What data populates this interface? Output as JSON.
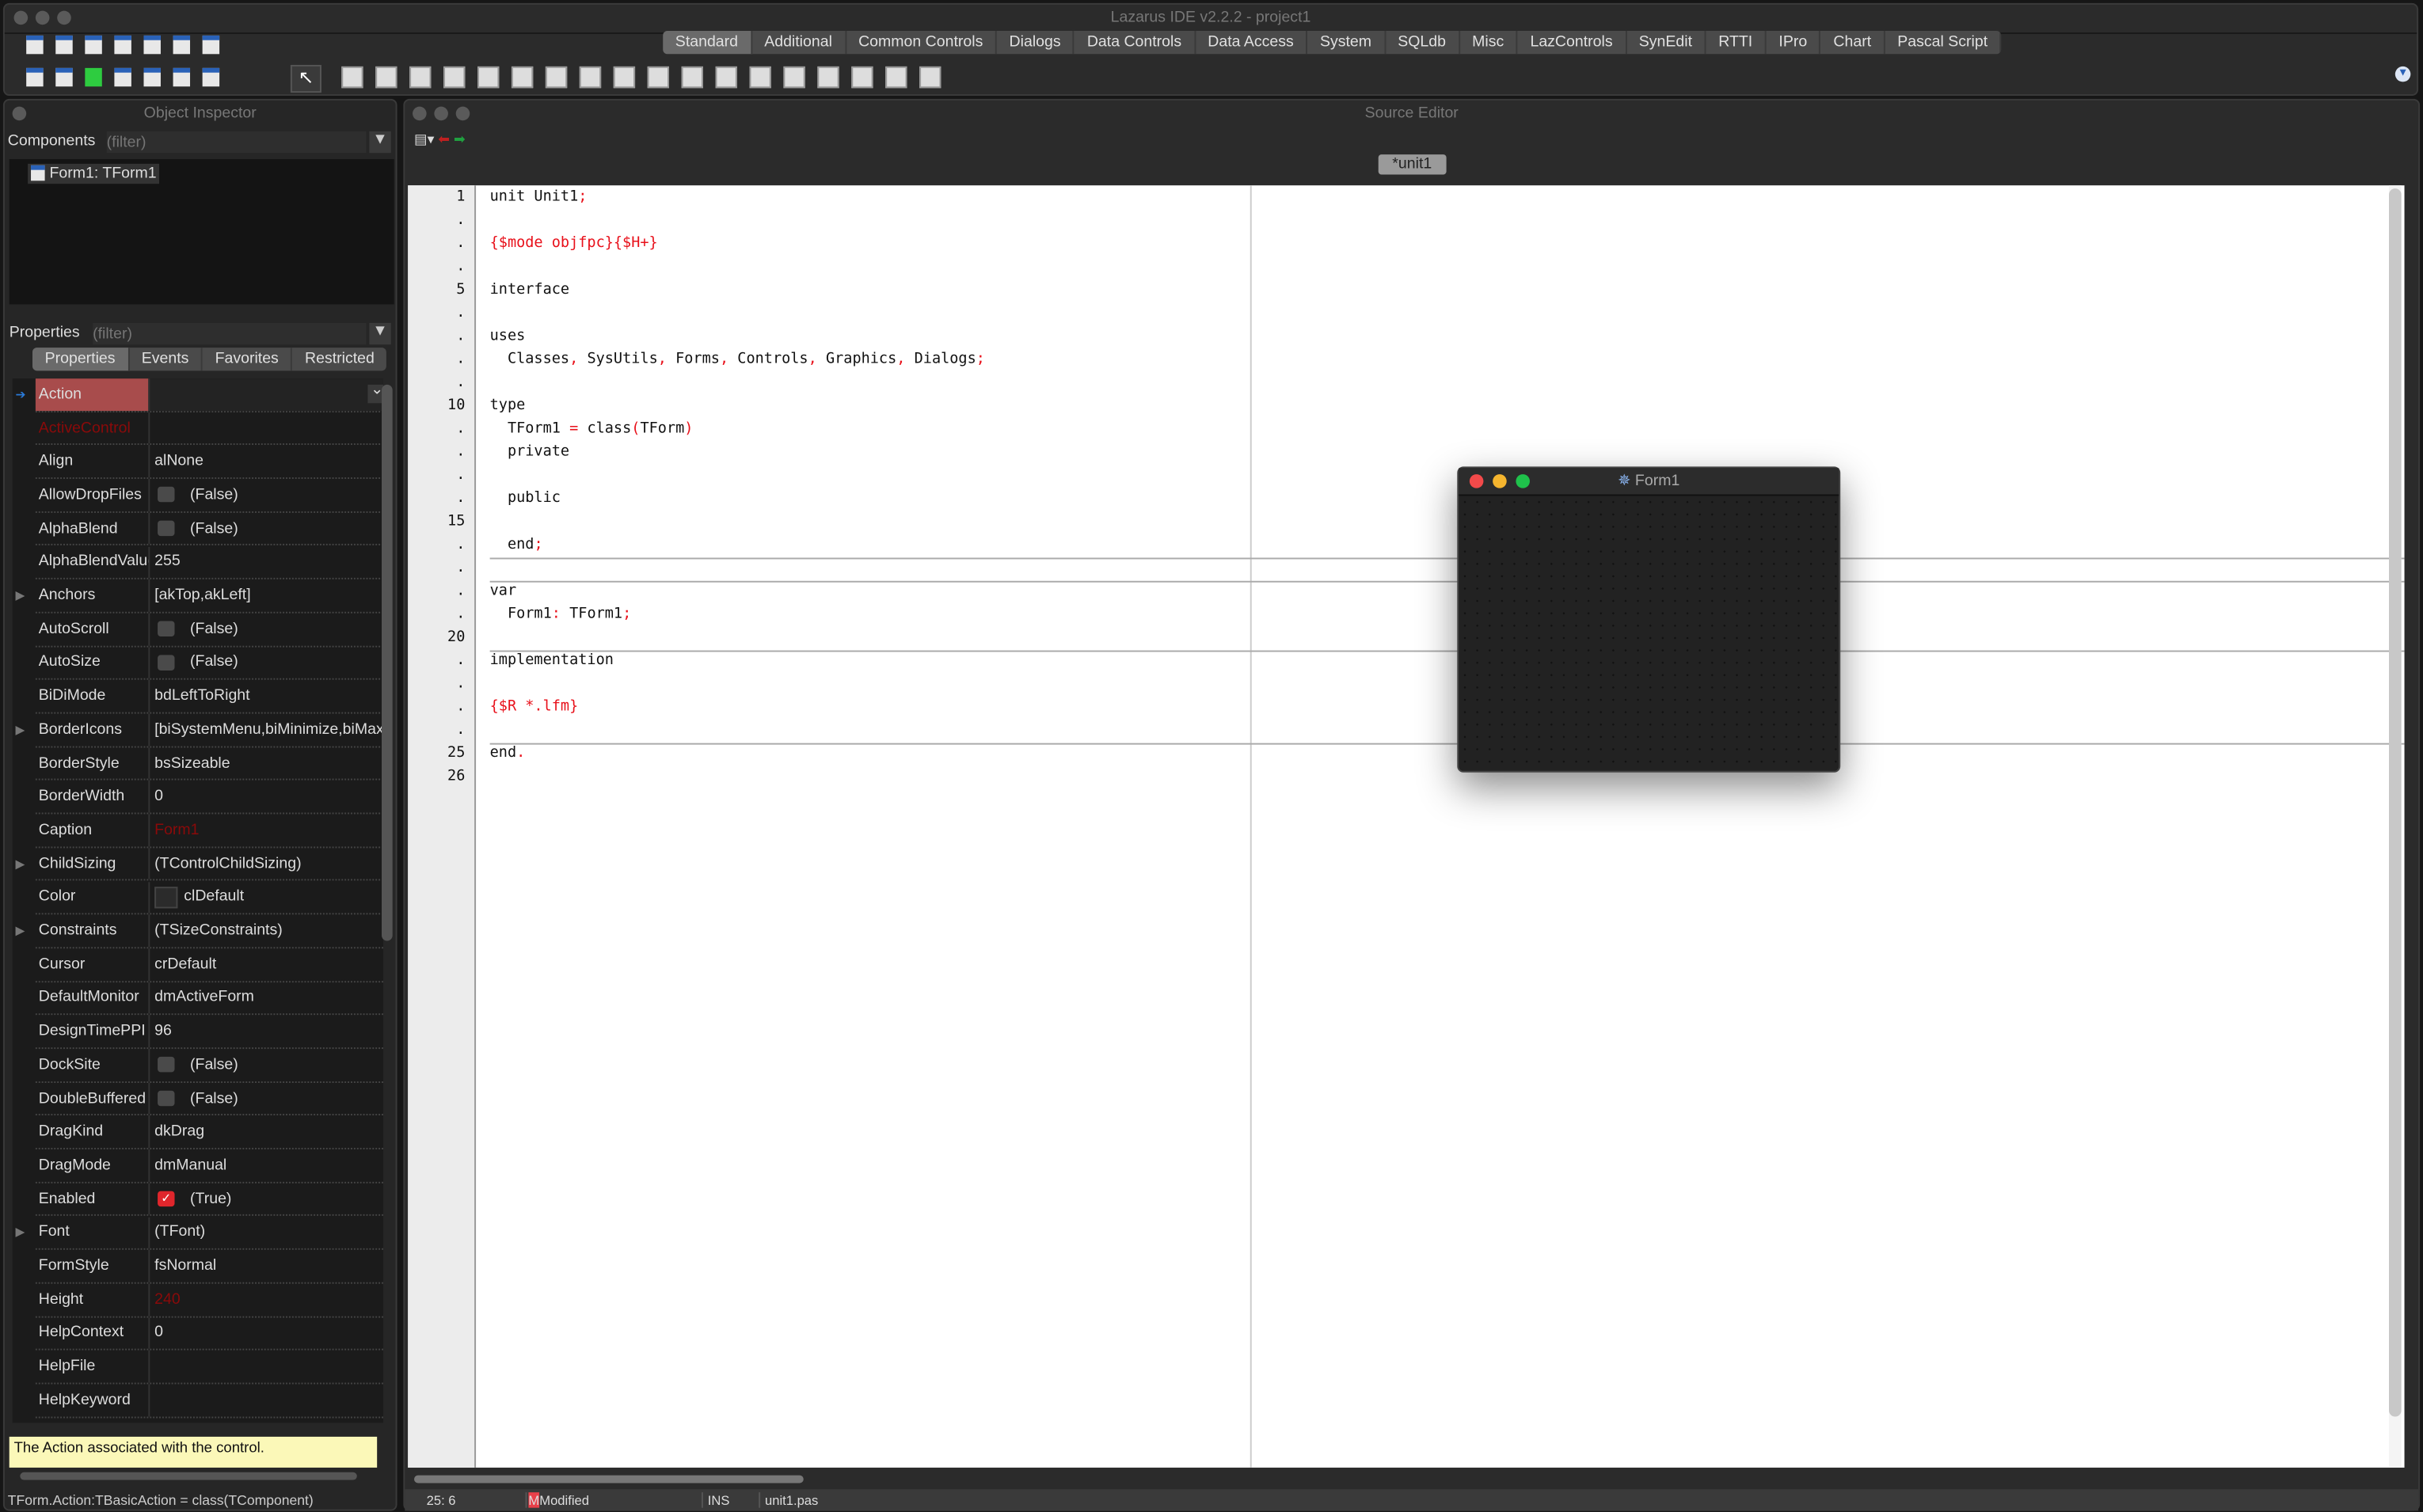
{
  "main_window": {
    "title": "Lazarus IDE v2.2.2 - project1",
    "palette_tabs": [
      "Standard",
      "Additional",
      "Common Controls",
      "Dialogs",
      "Data Controls",
      "Data Access",
      "System",
      "SQLdb",
      "Misc",
      "LazControls",
      "SynEdit",
      "RTTI",
      "IPro",
      "Chart",
      "Pascal Script"
    ],
    "active_tab": "Standard",
    "toolbar_icons": [
      "new-unit-icon",
      "new-form-icon",
      "open-icon",
      "save-icon",
      "save-all-icon",
      "toggle-form-unit-icon",
      "view-forms-icon",
      "view-units-icon",
      "project-options-icon",
      "run-icon",
      "pause-icon",
      "stop-icon",
      "step-into-icon",
      "step-over-icon"
    ],
    "component_icons": [
      "tmainmenu-icon",
      "tpopupmenu-icon",
      "tbutton-icon",
      "tlabel-icon",
      "tedit-icon",
      "tmemo-icon",
      "ttogglebox-icon",
      "tcheckbox-icon",
      "tradiobutton-icon",
      "tlistbox-icon",
      "tcombobox-icon",
      "tscrollbar-icon",
      "tgroupbox-icon",
      "tradiogroup-icon",
      "tcheckgroup-icon",
      "tpanel-icon",
      "tframe-icon",
      "tactionlist-icon"
    ]
  },
  "object_inspector": {
    "title": "Object Inspector",
    "components_label": "Components",
    "components_filter_placeholder": "(filter)",
    "tree_item": "Form1: TForm1",
    "properties_label": "Properties",
    "properties_filter_placeholder": "(filter)",
    "tabs": [
      "Properties",
      "Events",
      "Favorites",
      "Restricted"
    ],
    "active_tab": "Properties",
    "properties": [
      {
        "name": "Action",
        "value": "",
        "selected": true
      },
      {
        "name": "ActiveControl",
        "value": "",
        "modified": true
      },
      {
        "name": "Align",
        "value": "alNone"
      },
      {
        "name": "AllowDropFiles",
        "value": "(False)",
        "checkbox": false
      },
      {
        "name": "AlphaBlend",
        "value": "(False)",
        "checkbox": false
      },
      {
        "name": "AlphaBlendValue",
        "value": "255"
      },
      {
        "name": "Anchors",
        "value": "[akTop,akLeft]",
        "expandable": true
      },
      {
        "name": "AutoScroll",
        "value": "(False)",
        "checkbox": false
      },
      {
        "name": "AutoSize",
        "value": "(False)",
        "checkbox": false
      },
      {
        "name": "BiDiMode",
        "value": "bdLeftToRight"
      },
      {
        "name": "BorderIcons",
        "value": "[biSystemMenu,biMinimize,biMaximize]",
        "expandable": true
      },
      {
        "name": "BorderStyle",
        "value": "bsSizeable"
      },
      {
        "name": "BorderWidth",
        "value": "0"
      },
      {
        "name": "Caption",
        "value": "Form1",
        "value_modified": true
      },
      {
        "name": "ChildSizing",
        "value": "(TControlChildSizing)",
        "expandable": true
      },
      {
        "name": "Color",
        "value": "clDefault",
        "swatch": "#2b2b2b"
      },
      {
        "name": "Constraints",
        "value": "(TSizeConstraints)",
        "expandable": true
      },
      {
        "name": "Cursor",
        "value": "crDefault"
      },
      {
        "name": "DefaultMonitor",
        "value": "dmActiveForm"
      },
      {
        "name": "DesignTimePPI",
        "value": "96"
      },
      {
        "name": "DockSite",
        "value": "(False)",
        "checkbox": false
      },
      {
        "name": "DoubleBuffered",
        "value": "(False)",
        "checkbox": false
      },
      {
        "name": "DragKind",
        "value": "dkDrag"
      },
      {
        "name": "DragMode",
        "value": "dmManual"
      },
      {
        "name": "Enabled",
        "value": "(True)",
        "checkbox": true
      },
      {
        "name": "Font",
        "value": "(TFont)",
        "expandable": true
      },
      {
        "name": "FormStyle",
        "value": "fsNormal"
      },
      {
        "name": "Height",
        "value": "240",
        "value_modified": true
      },
      {
        "name": "HelpContext",
        "value": "0"
      },
      {
        "name": "HelpFile",
        "value": ""
      },
      {
        "name": "HelpKeyword",
        "value": ""
      }
    ],
    "hint": "The Action associated with the control.",
    "status": "TForm.Action:TBasicAction = class(TComponent)"
  },
  "source_editor": {
    "title": "Source Editor",
    "tab": "*unit1",
    "gutter": [
      "1",
      ".",
      ".",
      ".",
      "5",
      ".",
      ".",
      ".",
      ".",
      "10",
      ".",
      ".",
      ".",
      ".",
      "15",
      ".",
      ".",
      ".",
      ".",
      "20",
      ".",
      ".",
      ".",
      ".",
      "25",
      "26"
    ],
    "lines": [
      "unit Unit1;",
      "",
      "{$mode objfpc}{$H+}",
      "",
      "interface",
      "",
      "uses",
      "  Classes, SysUtils, Forms, Controls, Graphics, Dialogs;",
      "",
      "type",
      "  TForm1 = class(TForm)",
      "  private",
      "",
      "  public",
      "",
      "  end;",
      "",
      "var",
      "  Form1: TForm1;",
      "",
      "implementation",
      "",
      "{$R *.lfm}",
      "",
      "end.",
      ""
    ],
    "status": {
      "cursor": "25:  6",
      "modified_flag": "M",
      "modified": "Modified",
      "mode": "INS",
      "file": "unit1.pas"
    }
  },
  "designer_form": {
    "title": "Form1"
  },
  "colors": {
    "accent_red": "#e8101a",
    "selected_row": "#a84c4c",
    "hint_bg": "#fbf8b8"
  }
}
